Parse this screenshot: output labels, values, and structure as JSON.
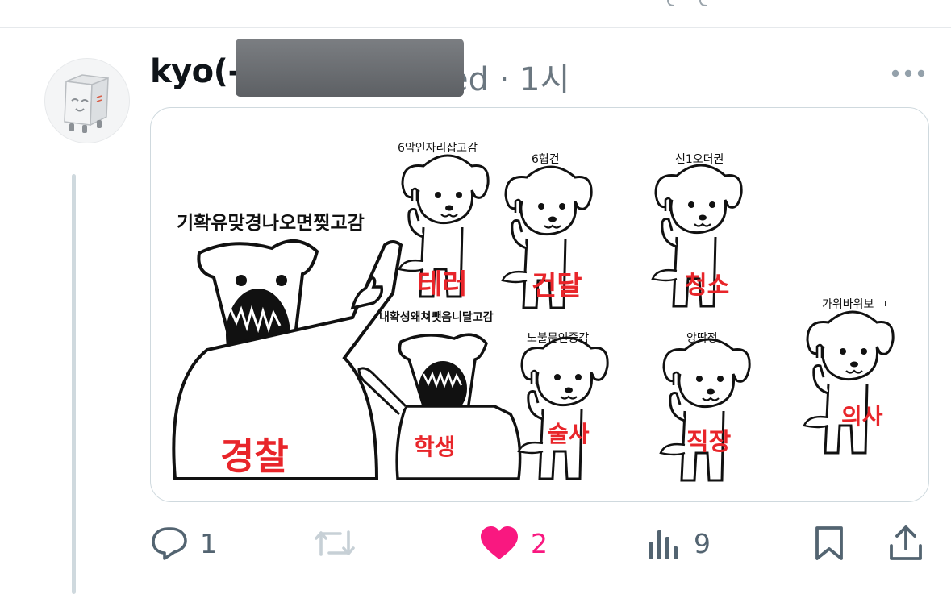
{
  "post": {
    "author_name_visible": "kyo(-",
    "handle_suffix_visible": "ed",
    "timestamp": "· 1시"
  },
  "image_text": {
    "headline": "기확유맞경나오면찢고감",
    "sub_headline": "내확성왜쳐뺏음니달고감",
    "top_dogs": [
      {
        "caption": "6악인자리잡고감",
        "tag": "테러"
      },
      {
        "caption": "6협건",
        "tag": "건달"
      },
      {
        "caption": "선1오더권",
        "tag": "청소"
      }
    ],
    "bottom_dogs": [
      {
        "caption": "노불문인증감",
        "tag": "술사"
      },
      {
        "caption": "앙딱정",
        "tag": "직장"
      },
      {
        "caption": "가위바위보 ㄱ",
        "tag": "의사"
      }
    ],
    "big_dog_tag": "경찰",
    "mid_dog_tag": "학생"
  },
  "actions": {
    "reply_count": "1",
    "repost_count": "",
    "like_count": "2",
    "views_count": "9"
  },
  "colors": {
    "like_pink": "#f91880",
    "icon_gray": "#536471",
    "repost_gray": "#c7d0d6",
    "thread_line": "#cfd9de",
    "marker_red": "#e8252a"
  },
  "icons": [
    "more-icon",
    "reply-icon",
    "repost-icon",
    "heart-icon",
    "views-icon",
    "bookmark-icon",
    "share-icon"
  ]
}
